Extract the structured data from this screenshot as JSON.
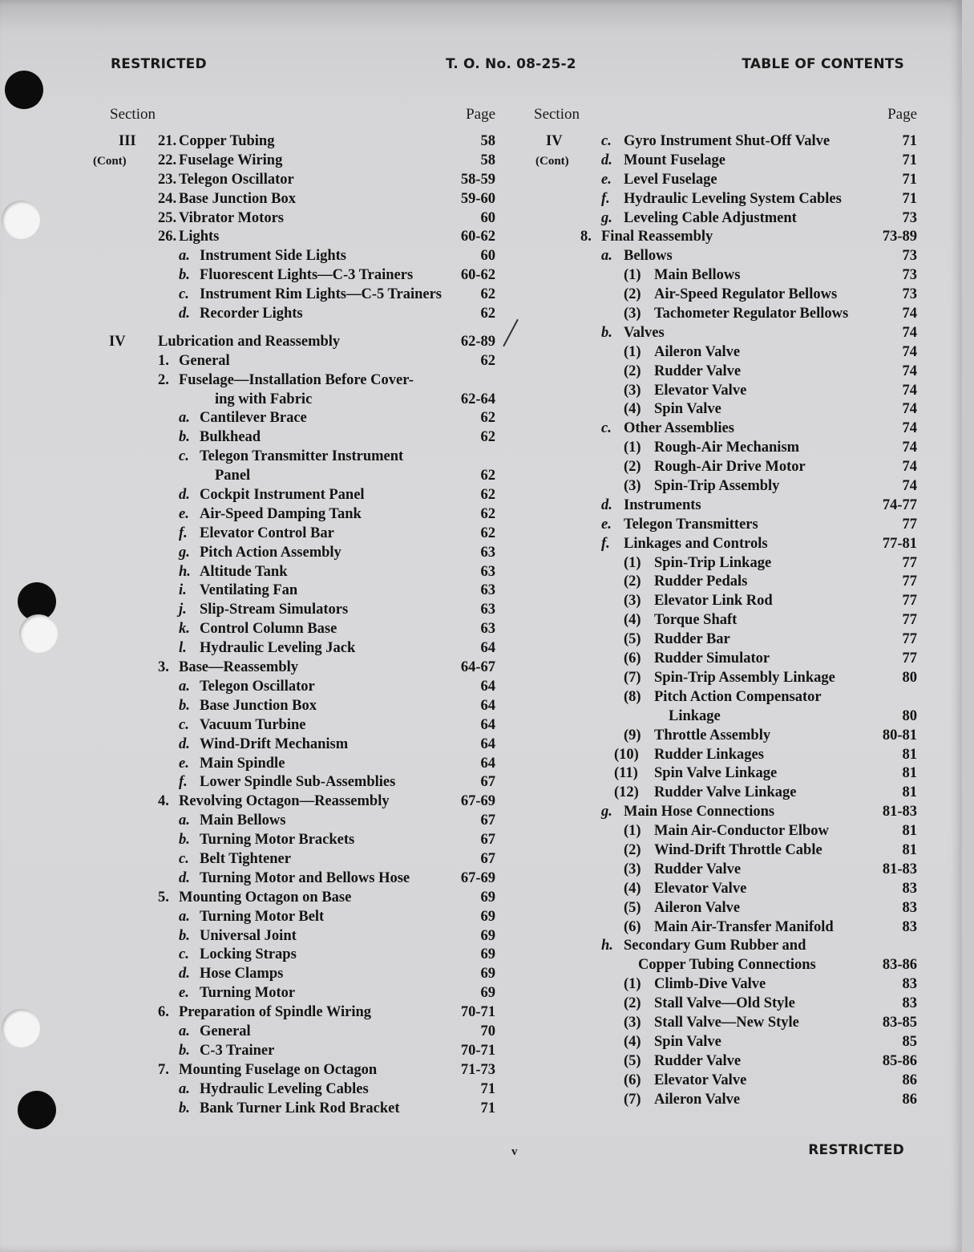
{
  "header": {
    "left": "RESTRICTED",
    "center": "T. O. No. 08-25-2",
    "right": "TABLE OF CONTENTS"
  },
  "columns": [
    {
      "section_label": "Section",
      "page_label": "Page",
      "rows": [
        {
          "sec": "III",
          "level": 1,
          "mark": "21.",
          "text": "Copper Tubing",
          "page": "58"
        },
        {
          "sec": "(Cont)",
          "level": 1,
          "mark": "22.",
          "text": "Fuselage Wiring",
          "page": "58"
        },
        {
          "sec": "",
          "level": 1,
          "mark": "23.",
          "text": "Telegon Oscillator",
          "page": "58-59"
        },
        {
          "sec": "",
          "level": 1,
          "mark": "24.",
          "text": "Base Junction Box",
          "page": "59-60"
        },
        {
          "sec": "",
          "level": 1,
          "mark": "25.",
          "text": "Vibrator Motors",
          "page": "60"
        },
        {
          "sec": "",
          "level": 1,
          "mark": "26.",
          "text": "Lights",
          "page": "60-62"
        },
        {
          "sec": "",
          "level": 2,
          "mark": "a.",
          "text": "Instrument Side Lights",
          "page": "60"
        },
        {
          "sec": "",
          "level": 2,
          "mark": "b.",
          "text": "Fluorescent Lights—C-3 Trainers",
          "page": "60-62"
        },
        {
          "sec": "",
          "level": 2,
          "mark": "c.",
          "text": "Instrument Rim Lights—C-5 Trainers",
          "page": "62"
        },
        {
          "sec": "",
          "level": 2,
          "mark": "d.",
          "text": "Recorder Lights",
          "page": "62"
        },
        {
          "sec": "IV",
          "level": 0,
          "mark": "",
          "text": "Lubrication and Reassembly",
          "page": "62-89",
          "gap": true
        },
        {
          "sec": "",
          "level": 1,
          "mark": "1.",
          "text": "General",
          "page": "62"
        },
        {
          "sec": "",
          "level": 1,
          "mark": "2.",
          "text": "Fuselage—Installation Before Cover-",
          "page": ""
        },
        {
          "sec": "",
          "level": 3,
          "mark": "",
          "text": "ing with Fabric",
          "page": "62-64"
        },
        {
          "sec": "",
          "level": 2,
          "mark": "a.",
          "text": "Cantilever Brace",
          "page": "62"
        },
        {
          "sec": "",
          "level": 2,
          "mark": "b.",
          "text": "Bulkhead",
          "page": "62"
        },
        {
          "sec": "",
          "level": 2,
          "mark": "c.",
          "text": "Telegon Transmitter Instrument",
          "page": ""
        },
        {
          "sec": "",
          "level": 4,
          "mark": "",
          "text": "Panel",
          "page": "62"
        },
        {
          "sec": "",
          "level": 2,
          "mark": "d.",
          "text": "Cockpit Instrument Panel",
          "page": "62"
        },
        {
          "sec": "",
          "level": 2,
          "mark": "e.",
          "text": "Air-Speed Damping Tank",
          "page": "62"
        },
        {
          "sec": "",
          "level": 2,
          "mark": "f.",
          "text": "Elevator Control Bar",
          "page": "62"
        },
        {
          "sec": "",
          "level": 2,
          "mark": "g.",
          "text": "Pitch Action Assembly",
          "page": "63"
        },
        {
          "sec": "",
          "level": 2,
          "mark": "h.",
          "text": "Altitude Tank",
          "page": "63"
        },
        {
          "sec": "",
          "level": 2,
          "mark": "i.",
          "text": "Ventilating Fan",
          "page": "63"
        },
        {
          "sec": "",
          "level": 2,
          "mark": "j.",
          "text": "Slip-Stream Simulators",
          "page": "63"
        },
        {
          "sec": "",
          "level": 2,
          "mark": "k.",
          "text": "Control Column Base",
          "page": "63"
        },
        {
          "sec": "",
          "level": 2,
          "mark": "l.",
          "text": "Hydraulic Leveling Jack",
          "page": "64"
        },
        {
          "sec": "",
          "level": 1,
          "mark": "3.",
          "text": "Base—Reassembly",
          "page": "64-67"
        },
        {
          "sec": "",
          "level": 2,
          "mark": "a.",
          "text": "Telegon Oscillator",
          "page": "64"
        },
        {
          "sec": "",
          "level": 2,
          "mark": "b.",
          "text": "Base Junction Box",
          "page": "64"
        },
        {
          "sec": "",
          "level": 2,
          "mark": "c.",
          "text": "Vacuum Turbine",
          "page": "64"
        },
        {
          "sec": "",
          "level": 2,
          "mark": "d.",
          "text": "Wind-Drift Mechanism",
          "page": "64"
        },
        {
          "sec": "",
          "level": 2,
          "mark": "e.",
          "text": "Main Spindle",
          "page": "64"
        },
        {
          "sec": "",
          "level": 2,
          "mark": "f.",
          "text": "Lower Spindle Sub-Assemblies",
          "page": "67"
        },
        {
          "sec": "",
          "level": 1,
          "mark": "4.",
          "text": "Revolving Octagon—Reassembly",
          "page": "67-69"
        },
        {
          "sec": "",
          "level": 2,
          "mark": "a.",
          "text": "Main Bellows",
          "page": "67"
        },
        {
          "sec": "",
          "level": 2,
          "mark": "b.",
          "text": "Turning Motor Brackets",
          "page": "67"
        },
        {
          "sec": "",
          "level": 2,
          "mark": "c.",
          "text": "Belt Tightener",
          "page": "67"
        },
        {
          "sec": "",
          "level": 2,
          "mark": "d.",
          "text": "Turning Motor and Bellows Hose",
          "page": "67-69"
        },
        {
          "sec": "",
          "level": 1,
          "mark": "5.",
          "text": "Mounting Octagon on Base",
          "page": "69"
        },
        {
          "sec": "",
          "level": 2,
          "mark": "a.",
          "text": "Turning Motor Belt",
          "page": "69"
        },
        {
          "sec": "",
          "level": 2,
          "mark": "b.",
          "text": "Universal Joint",
          "page": "69"
        },
        {
          "sec": "",
          "level": 2,
          "mark": "c.",
          "text": "Locking Straps",
          "page": "69"
        },
        {
          "sec": "",
          "level": 2,
          "mark": "d.",
          "text": "Hose Clamps",
          "page": "69"
        },
        {
          "sec": "",
          "level": 2,
          "mark": "e.",
          "text": "Turning Motor",
          "page": "69"
        },
        {
          "sec": "",
          "level": 1,
          "mark": "6.",
          "text": "Preparation of Spindle Wiring",
          "page": "70-71"
        },
        {
          "sec": "",
          "level": 2,
          "mark": "a.",
          "text": "General",
          "page": "70"
        },
        {
          "sec": "",
          "level": 2,
          "mark": "b.",
          "text": "C-3 Trainer",
          "page": "70-71"
        },
        {
          "sec": "",
          "level": 1,
          "mark": "7.",
          "text": "Mounting Fuselage on Octagon",
          "page": "71-73"
        },
        {
          "sec": "",
          "level": 2,
          "mark": "a.",
          "text": "Hydraulic Leveling Cables",
          "page": "71"
        },
        {
          "sec": "",
          "level": 2,
          "mark": "b.",
          "text": "Bank Turner Link Rod Bracket",
          "page": "71"
        }
      ]
    },
    {
      "section_label": "Section",
      "page_label": "Page",
      "rows": [
        {
          "sec": "IV",
          "level": 2,
          "mark": "c.",
          "text": "Gyro Instrument Shut-Off Valve",
          "page": "71"
        },
        {
          "sec": "(Cont)",
          "level": 2,
          "mark": "d.",
          "text": "Mount Fuselage",
          "page": "71"
        },
        {
          "sec": "",
          "level": 2,
          "mark": "e.",
          "text": "Level Fuselage",
          "page": "71"
        },
        {
          "sec": "",
          "level": 2,
          "mark": "f.",
          "text": "Hydraulic Leveling System Cables",
          "page": "71"
        },
        {
          "sec": "",
          "level": 2,
          "mark": "g.",
          "text": "Leveling Cable Adjustment",
          "page": "73"
        },
        {
          "sec": "",
          "level": 1,
          "mark": "8.",
          "text": "Final Reassembly",
          "page": "73-89"
        },
        {
          "sec": "",
          "level": 2,
          "mark": "a.",
          "text": "Bellows",
          "page": "73"
        },
        {
          "sec": "",
          "level": 3,
          "mark": "(1)",
          "text": "Main Bellows",
          "page": "73"
        },
        {
          "sec": "",
          "level": 3,
          "mark": "(2)",
          "text": "Air-Speed Regulator Bellows",
          "page": "73"
        },
        {
          "sec": "",
          "level": 3,
          "mark": "(3)",
          "text": "Tachometer Regulator Bellows",
          "page": "74"
        },
        {
          "sec": "",
          "level": 2,
          "mark": "b.",
          "text": "Valves",
          "page": "74"
        },
        {
          "sec": "",
          "level": 3,
          "mark": "(1)",
          "text": "Aileron Valve",
          "page": "74"
        },
        {
          "sec": "",
          "level": 3,
          "mark": "(2)",
          "text": "Rudder Valve",
          "page": "74"
        },
        {
          "sec": "",
          "level": 3,
          "mark": "(3)",
          "text": "Elevator Valve",
          "page": "74"
        },
        {
          "sec": "",
          "level": 3,
          "mark": "(4)",
          "text": "Spin Valve",
          "page": "74"
        },
        {
          "sec": "",
          "level": 2,
          "mark": "c.",
          "text": "Other Assemblies",
          "page": "74"
        },
        {
          "sec": "",
          "level": 3,
          "mark": "(1)",
          "text": "Rough-Air Mechanism",
          "page": "74"
        },
        {
          "sec": "",
          "level": 3,
          "mark": "(2)",
          "text": "Rough-Air Drive Motor",
          "page": "74"
        },
        {
          "sec": "",
          "level": 3,
          "mark": "(3)",
          "text": "Spin-Trip Assembly",
          "page": "74"
        },
        {
          "sec": "",
          "level": 2,
          "mark": "d.",
          "text": "Instruments",
          "page": "74-77"
        },
        {
          "sec": "",
          "level": 2,
          "mark": "e.",
          "text": "Telegon Transmitters",
          "page": "77"
        },
        {
          "sec": "",
          "level": 2,
          "mark": "f.",
          "text": "Linkages and Controls",
          "page": "77-81"
        },
        {
          "sec": "",
          "level": 3,
          "mark": "(1)",
          "text": "Spin-Trip Linkage",
          "page": "77"
        },
        {
          "sec": "",
          "level": 3,
          "mark": "(2)",
          "text": "Rudder Pedals",
          "page": "77"
        },
        {
          "sec": "",
          "level": 3,
          "mark": "(3)",
          "text": "Elevator Link Rod",
          "page": "77"
        },
        {
          "sec": "",
          "level": 3,
          "mark": "(4)",
          "text": "Torque Shaft",
          "page": "77"
        },
        {
          "sec": "",
          "level": 3,
          "mark": "(5)",
          "text": "Rudder Bar",
          "page": "77"
        },
        {
          "sec": "",
          "level": 3,
          "mark": "(6)",
          "text": "Rudder Simulator",
          "page": "77"
        },
        {
          "sec": "",
          "level": 3,
          "mark": "(7)",
          "text": "Spin-Trip Assembly Linkage",
          "page": "80"
        },
        {
          "sec": "",
          "level": 3,
          "mark": "(8)",
          "text": "Pitch Action Compensator",
          "page": ""
        },
        {
          "sec": "",
          "level": 5,
          "mark": "",
          "text": "Linkage",
          "page": "80"
        },
        {
          "sec": "",
          "level": 3,
          "mark": "(9)",
          "text": "Throttle Assembly",
          "page": "80-81"
        },
        {
          "sec": "",
          "level": 6,
          "mark": "(10)",
          "text": "Rudder Linkages",
          "page": "81"
        },
        {
          "sec": "",
          "level": 6,
          "mark": "(11)",
          "text": "Spin Valve Linkage",
          "page": "81"
        },
        {
          "sec": "",
          "level": 6,
          "mark": "(12)",
          "text": "Rudder Valve Linkage",
          "page": "81"
        },
        {
          "sec": "",
          "level": 2,
          "mark": "g.",
          "text": "Main Hose Connections",
          "page": "81-83"
        },
        {
          "sec": "",
          "level": 3,
          "mark": "(1)",
          "text": "Main Air-Conductor Elbow",
          "page": "81"
        },
        {
          "sec": "",
          "level": 3,
          "mark": "(2)",
          "text": "Wind-Drift Throttle Cable",
          "page": "81"
        },
        {
          "sec": "",
          "level": 3,
          "mark": "(3)",
          "text": "Rudder Valve",
          "page": "81-83"
        },
        {
          "sec": "",
          "level": 3,
          "mark": "(4)",
          "text": "Elevator Valve",
          "page": "83"
        },
        {
          "sec": "",
          "level": 3,
          "mark": "(5)",
          "text": "Aileron Valve",
          "page": "83"
        },
        {
          "sec": "",
          "level": 3,
          "mark": "(6)",
          "text": "Main Air-Transfer Manifold",
          "page": "83"
        },
        {
          "sec": "",
          "level": 2,
          "mark": "h.",
          "text": "Secondary Gum Rubber and",
          "page": ""
        },
        {
          "sec": "",
          "level": 7,
          "mark": "",
          "text": "Copper Tubing Connections",
          "page": "83-86"
        },
        {
          "sec": "",
          "level": 3,
          "mark": "(1)",
          "text": "Climb-Dive Valve",
          "page": "83"
        },
        {
          "sec": "",
          "level": 3,
          "mark": "(2)",
          "text": "Stall Valve—Old Style",
          "page": "83"
        },
        {
          "sec": "",
          "level": 3,
          "mark": "(3)",
          "text": "Stall Valve—New Style",
          "page": "83-85"
        },
        {
          "sec": "",
          "level": 3,
          "mark": "(4)",
          "text": "Spin Valve",
          "page": "85"
        },
        {
          "sec": "",
          "level": 3,
          "mark": "(5)",
          "text": "Rudder Valve",
          "page": "85-86"
        },
        {
          "sec": "",
          "level": 3,
          "mark": "(6)",
          "text": "Elevator Valve",
          "page": "86"
        },
        {
          "sec": "",
          "level": 3,
          "mark": "(7)",
          "text": "Aileron Valve",
          "page": "86"
        }
      ]
    }
  ],
  "footer": {
    "page_number": "v",
    "right": "RESTRICTED"
  }
}
